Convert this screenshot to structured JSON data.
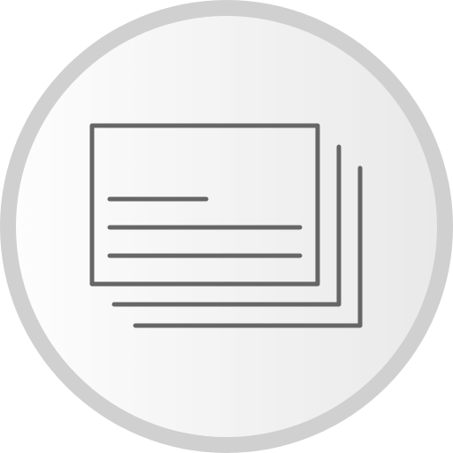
{
  "icon": {
    "name": "stacked-cards-icon",
    "colors": {
      "ring": "#d0d0d0",
      "fill_light": "#fdfdfd",
      "fill_dark": "#e9e9e9",
      "stroke": "#666666"
    }
  }
}
